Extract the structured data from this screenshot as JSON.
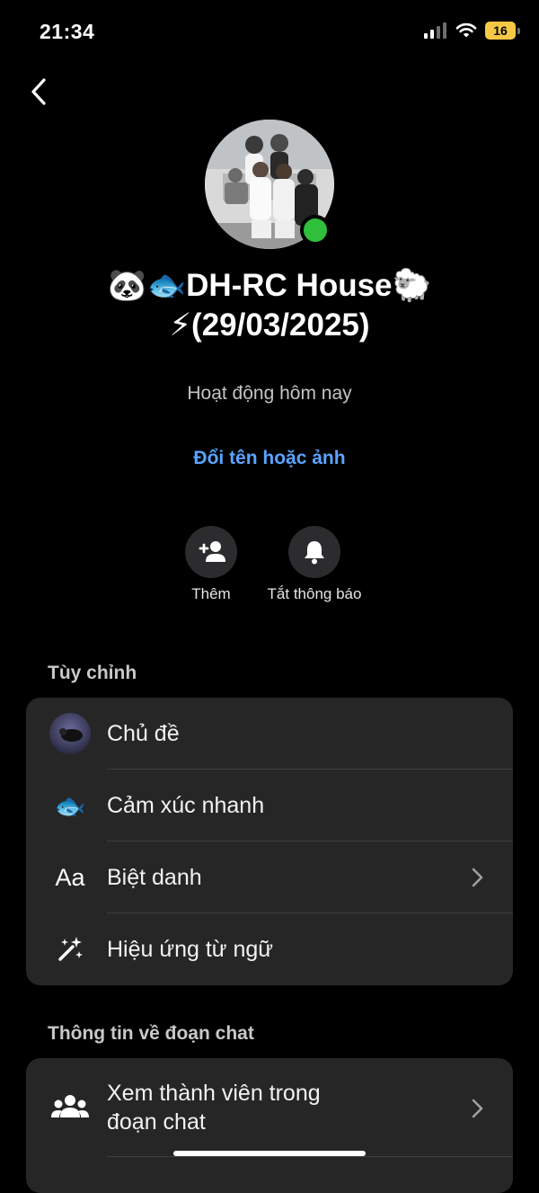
{
  "status_bar": {
    "time": "21:34",
    "battery": "16"
  },
  "header": {
    "group_name": "🐼🐟DH-RC House🐑⚡(29/03/2025)",
    "activity": "Hoạt động hôm nay",
    "rename_link": "Đổi tên hoặc ảnh"
  },
  "actions": [
    {
      "label": "Thêm",
      "icon": "add-person-icon"
    },
    {
      "label": "Tắt thông báo",
      "icon": "bell-icon"
    }
  ],
  "customize": {
    "title": "Tùy chỉnh",
    "items": [
      {
        "label": "Chủ đề",
        "icon": "theme-thumbnail"
      },
      {
        "label": "Cảm xúc nhanh",
        "icon": "fish-emoji-icon",
        "emoji": "🐟"
      },
      {
        "label": "Biệt danh",
        "icon": "Aa",
        "has_chevron": true
      },
      {
        "label": "Hiệu ứng từ ngữ",
        "icon": "magic-wand-icon"
      }
    ]
  },
  "chat_info": {
    "title": "Thông tin về đoạn chat",
    "items": [
      {
        "label": "Xem thành viên trong đoạn chat",
        "icon": "members-icon",
        "has_chevron": true
      }
    ]
  },
  "colors": {
    "background": "#000000",
    "card": "#262626",
    "accent_link": "#5aa4ff",
    "online": "#2fbf3a",
    "battery": "#f6c945"
  }
}
